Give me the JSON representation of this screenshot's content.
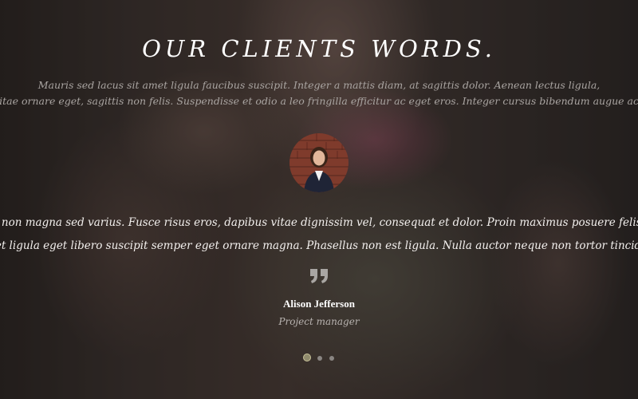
{
  "section": {
    "heading": "OUR CLIENTS WORDS.",
    "intro_line_1": "Mauris sed lacus sit amet ligula faucibus suscipit. Integer a mattis diam, at sagittis dolor. Aenean lectus ligula,",
    "intro_line_2": "ttis vitae ornare eget, sagittis non felis. Suspendisse et odio a leo fringilla efficitur ac eget eros. Integer cursus bibendum augue ac curs"
  },
  "testimonial": {
    "avatar_icon": "person-photo",
    "quote_line_1": "ibus non magna sed varius. Fusce risus eros, dapibus vitae dignissim vel, consequat et dolor. Proin maximus posuere felis a ti",
    "quote_line_2": "amet ligula eget libero suscipit semper eget ornare magna. Phasellus non est ligula. Nulla auctor neque non tortor tincidunt",
    "quote_icon": "quote-icon",
    "name": "Alison Jefferson",
    "role": "Project manager"
  },
  "carousel": {
    "slide_count": 3,
    "active_index": 0
  },
  "colors": {
    "heading": "#ffffff",
    "intro_text": "#a9a4a1",
    "quote_text": "#f3f0ee",
    "role_text": "#b8b3b0",
    "active_dot": "#8f8a6c",
    "inactive_dot": "#8a8683"
  }
}
